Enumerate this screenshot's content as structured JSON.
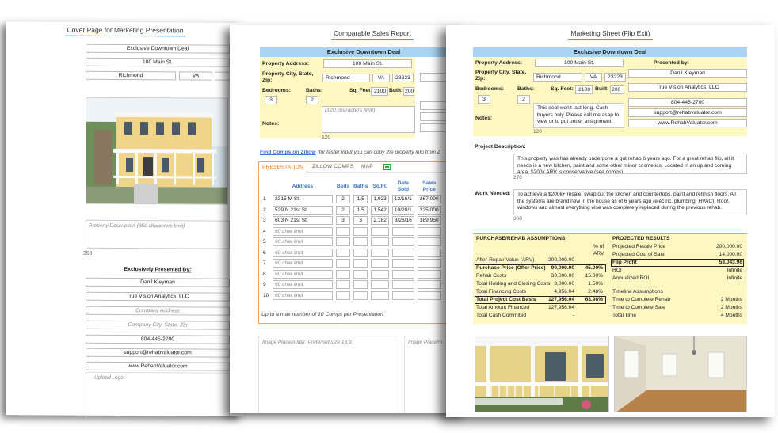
{
  "cover": {
    "title": "Cover Page for Marketing Presentation",
    "headline": "Exclusive Downtown Deal",
    "address": "100 Main St.",
    "city": "Richmond",
    "state": "VA",
    "description_placeholder": "Property Description (350 characters limit)",
    "description_count": "350",
    "presented_by_label": "Exclusively Presented By:",
    "presenter_name": "Danil Kleyman",
    "company": "True Vision Analytics, LLC",
    "company_address_placeholder": "Company Address",
    "company_city_placeholder": "Company City, State, Zip",
    "phone": "804-445-2700",
    "email": "support@rehabvaluator.com",
    "website": "www.RehabValuator.com",
    "upload_logo": "Upload Logo"
  },
  "comps": {
    "title": "Comparable Sales Report",
    "banner": "Exclusive Downtown Deal",
    "property_address_label": "Property Address:",
    "property_address": "100 Main St.",
    "city_label": "Property City, State, Zip:",
    "city": "Richmond",
    "state": "VA",
    "zip": "23223",
    "bedrooms_label": "Bedrooms:",
    "bedrooms": "3",
    "baths_label": "Baths:",
    "baths": "2",
    "sqft_label": "Sq. Feet:",
    "sqft": "2100",
    "built_label": "Built:",
    "built": "200",
    "notes_label": "Notes:",
    "notes_placeholder": "(120 characters limit)",
    "notes_count": "120",
    "zillow_link": "Find Comps on Zillow",
    "zillow_hint": "(for faster input you can copy the property info from Z",
    "tabs": [
      "PRESENTATION",
      "ZILLOW COMPS",
      "MAP"
    ],
    "columns": [
      "Address",
      "Beds",
      "Baths",
      "Sq.Ft.",
      "Date Sold",
      "Sales Price"
    ],
    "rows": [
      {
        "n": "1",
        "address": "2315 M St.",
        "beds": "2",
        "baths": "1.5",
        "sqft": "1,923",
        "date": "12/16/1",
        "price": "267,000"
      },
      {
        "n": "2",
        "address": "529 N 21st St.",
        "beds": "2",
        "baths": "1.5",
        "sqft": "1,542",
        "date": "10/20/1",
        "price": "225,000"
      },
      {
        "n": "3",
        "address": "603 N 21st St.",
        "beds": "3",
        "baths": "3",
        "sqft": "2,182",
        "date": "8/26/16",
        "price": "389,950"
      },
      {
        "n": "4",
        "address": "60 char limit",
        "beds": "",
        "baths": "",
        "sqft": "",
        "date": "",
        "price": ""
      },
      {
        "n": "5",
        "address": "60 char limit",
        "beds": "",
        "baths": "",
        "sqft": "",
        "date": "",
        "price": ""
      },
      {
        "n": "6",
        "address": "60 char limit",
        "beds": "",
        "baths": "",
        "sqft": "",
        "date": "",
        "price": ""
      },
      {
        "n": "7",
        "address": "60 char limit",
        "beds": "",
        "baths": "",
        "sqft": "",
        "date": "",
        "price": ""
      },
      {
        "n": "8",
        "address": "60 char limit",
        "beds": "",
        "baths": "",
        "sqft": "",
        "date": "",
        "price": ""
      },
      {
        "n": "9",
        "address": "60 char limit",
        "beds": "",
        "baths": "",
        "sqft": "",
        "date": "",
        "price": ""
      },
      {
        "n": "10",
        "address": "60 char limit",
        "beds": "",
        "baths": "",
        "sqft": "",
        "date": "",
        "price": ""
      }
    ],
    "max_note": "Up to a max number of 10 Comps per Presentation",
    "image_placeholder": "Image Placeholder. Preferred size 16:9.",
    "image_placeholder_2": "Image Placeho"
  },
  "flip": {
    "title": "Marketing Sheet (Flip Exit)",
    "banner": "Exclusive Downtown Deal",
    "property_address_label": "Property Address:",
    "property_address": "100 Main St.",
    "city_label": "Property City, State, Zip:",
    "city": "Richmond",
    "state": "VA",
    "zip": "23223",
    "bedrooms_label": "Bedrooms:",
    "bedrooms": "3",
    "baths_label": "Baths:",
    "baths": "2",
    "sqft_label": "Sq. Feet:",
    "sqft": "2100",
    "built_label": "Built:",
    "built": "200",
    "notes_label": "Notes:",
    "notes": "This deal won't last long.  Cash buyers only.  Please call me asap to view or to put under assignment!",
    "notes_count": "120",
    "presented_by_label": "Presented by:",
    "presenter_name": "Danil Kleyman",
    "company": "True Vision Analytics, LLC",
    "phone": "804-445-2700",
    "email": "support@rehabvaluator.com",
    "website": "www.RehabValuator.com",
    "description_label": "Project Description:",
    "description": "This property was has already undergone a gut rehab 6 years ago.  For a great rehab flip, all it needs is a new kitchen, paint and some other minor cosmetics.  Located in an up and coming area, $200k ARV is conservative (see comps).",
    "description_count": "270",
    "work_label": "Work Needed:",
    "work": "To achieve a $200k+ resale, swap out the kitchen and countertops, paint and refinish floors.  All the systems are brand new in the house as of 6 years ago (electric, plumbing, HVAC).  Roof, windows and almost everything else was completely replaced during the previous rehab.",
    "work_count": "360",
    "assumptions_title": "PURCHASE/REHAB ASSUMPTIONS",
    "pct_header": "% of",
    "arv_header": "ARV",
    "assumptions": [
      {
        "label": "After-Repair Value (ARV)",
        "value": "200,000.00",
        "pct": ""
      },
      {
        "label": "Purchase Price (Offer Price)",
        "value": "90,000.00",
        "pct": "45.00%"
      },
      {
        "label": "Rehab Costs",
        "value": "30,000.00",
        "pct": "15.00%"
      },
      {
        "label": "Total Holding and Closing Costs",
        "value": "3,000.00",
        "pct": "1.50%"
      },
      {
        "label": "Total Financing Costs",
        "value": "4,956.04",
        "pct": "2.48%"
      },
      {
        "label": "Total Project Cost Basis",
        "value": "127,956.04",
        "pct": "63.98%"
      },
      {
        "label": "Total Amount Financed",
        "value": "127,956.04",
        "pct": ""
      },
      {
        "label": "Total Cash Commited",
        "value": "-",
        "pct": ""
      }
    ],
    "results_title": "PROJECTED RESULTS",
    "results": [
      {
        "label": "Projected Resale Price",
        "value": "200,000.00"
      },
      {
        "label": "Projected Cost of Sale",
        "value": "14,000.00"
      },
      {
        "label": "Flip Profit",
        "value": "58,043.96"
      },
      {
        "label": "ROI",
        "value": "Infinite"
      },
      {
        "label": "Annualized ROI",
        "value": "Infinite"
      }
    ],
    "timeline_title": "Timeline Assumptions",
    "timeline": [
      {
        "label": "Time to Complete Rehab",
        "value": "2 Months"
      },
      {
        "label": "Time to Complete Sale",
        "value": "2 Months"
      },
      {
        "label": "Total Time",
        "value": "4 Months"
      }
    ]
  },
  "colors": {
    "banner_blue": "#a9d4f2",
    "form_yellow": "#fff7c2",
    "tab_orange": "#e37a1f",
    "link_blue": "#3b76c9"
  }
}
